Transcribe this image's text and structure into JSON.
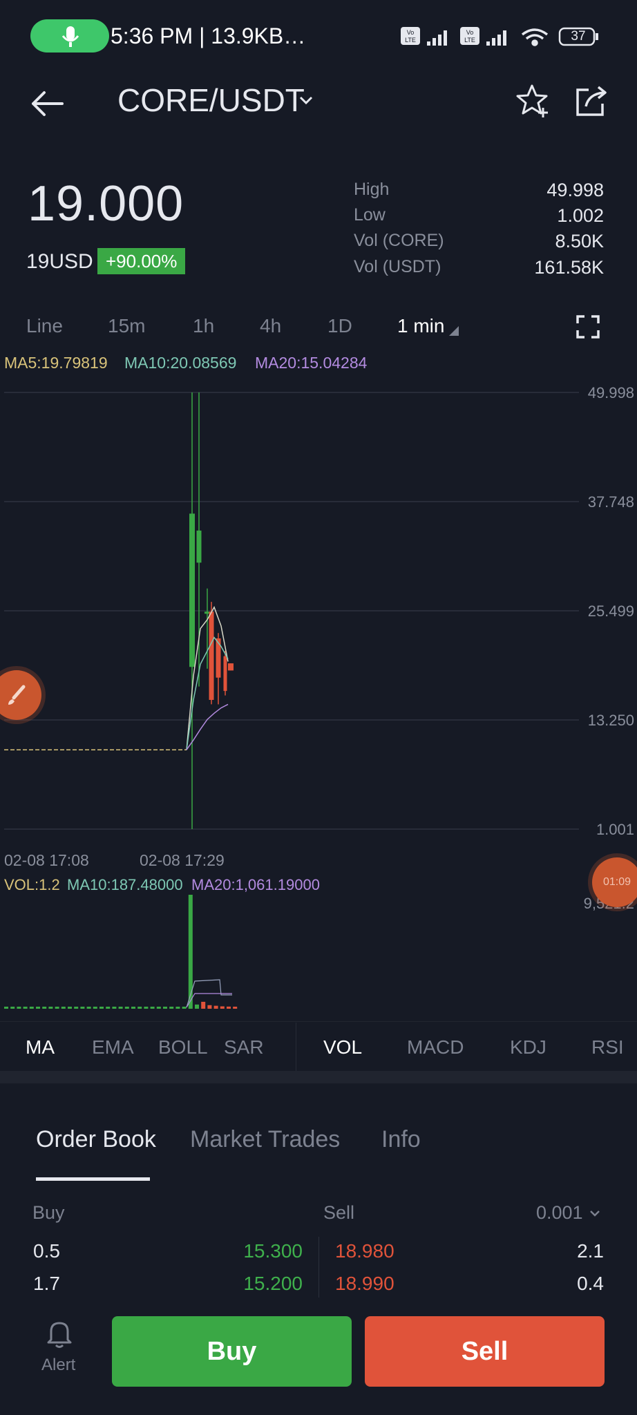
{
  "status_bar": {
    "time_text": "5:36 PM | 13.9KB…",
    "battery": "37",
    "icons": [
      "mic-icon",
      "volte-icon",
      "signal-icon",
      "volte-icon",
      "signal-icon",
      "wifi-icon",
      "battery-icon"
    ]
  },
  "header": {
    "title": "CORE/USDT",
    "icons": [
      "back-arrow-icon",
      "chevron-down-icon",
      "star-add-icon",
      "share-icon"
    ]
  },
  "price": {
    "last": "19.000",
    "fiat": "19USD",
    "change": "+90.00%",
    "stats": [
      {
        "label": "High",
        "value": "49.998"
      },
      {
        "label": "Low",
        "value": "1.002"
      },
      {
        "label": "Vol (CORE)",
        "value": "8.50K"
      },
      {
        "label": "Vol (USDT)",
        "value": "161.58K"
      }
    ]
  },
  "timeframes": [
    "Line",
    "15m",
    "1h",
    "4h",
    "1D",
    "1 min"
  ],
  "active_timeframe": "1 min",
  "ma_legend": {
    "ma5": "MA5:19.79819",
    "ma10": "MA10:20.08569",
    "ma20": "MA20:15.04284"
  },
  "chart_data": {
    "type": "candlestick",
    "y_axis_ticks": [
      "49.998",
      "37.748",
      "25.499",
      "13.250",
      "1.001"
    ],
    "ylim": [
      1.001,
      49.998
    ],
    "x_labels": [
      "02-08 17:08",
      "02-08 17:29"
    ],
    "candles": [
      {
        "open": 9.9,
        "close": 9.9,
        "high": 9.9,
        "low": 9.9,
        "color": "flat"
      },
      {
        "open": 19.2,
        "close": 36.4,
        "high": 49.998,
        "low": 1.002,
        "color": "up"
      },
      {
        "open": 30.9,
        "close": 34.5,
        "high": 49.998,
        "low": 17.0,
        "color": "up"
      },
      {
        "open": 25.4,
        "close": 25.4,
        "high": 28.0,
        "low": 19.0,
        "color": "up"
      },
      {
        "open": 25.4,
        "close": 15.5,
        "high": 26.5,
        "low": 15.0,
        "color": "down"
      },
      {
        "open": 22.4,
        "close": 18.0,
        "high": 23.0,
        "low": 15.0,
        "color": "down"
      },
      {
        "open": 20.4,
        "close": 16.5,
        "high": 21.0,
        "low": 16.0,
        "color": "down"
      },
      {
        "open": 19.6,
        "close": 18.8,
        "high": 19.6,
        "low": 18.8,
        "color": "down"
      }
    ],
    "volume": {
      "axis_max": "9,521.2",
      "legend": {
        "vol": "VOL:1.2",
        "ma10": "MA10:187.48000",
        "ma20": "MA20:1,061.19000"
      },
      "bars": [
        1,
        1,
        1,
        1,
        1,
        1,
        1,
        1,
        1,
        1,
        1,
        1,
        1,
        1,
        1,
        1,
        1,
        1,
        1,
        1,
        1,
        1,
        1,
        1,
        1,
        1,
        1,
        1,
        1,
        9521,
        350,
        580,
        300,
        250,
        200,
        180,
        150
      ]
    }
  },
  "colors": {
    "up": "#3aa845",
    "down": "#e0533a",
    "ma5": "#d9c37a",
    "ma10": "#7ec8b4",
    "ma20": "#b38be0",
    "background": "#161a25"
  },
  "indicators": {
    "main": [
      "MA",
      "EMA",
      "BOLL",
      "SAR"
    ],
    "sub": [
      "VOL",
      "MACD",
      "KDJ",
      "RSI"
    ],
    "active_main": "MA",
    "active_sub": "VOL"
  },
  "timer_bubble": "01:09",
  "tabs": [
    "Order Book",
    "Market Trades",
    "Info"
  ],
  "order_book": {
    "buy_header": "Buy",
    "sell_header": "Sell",
    "precision": "0.001",
    "rows": [
      {
        "buy_qty": "0.5",
        "buy_price": "15.300",
        "sell_price": "18.980",
        "sell_qty": "2.1"
      },
      {
        "buy_qty": "1.7",
        "buy_price": "15.200",
        "sell_price": "18.990",
        "sell_qty": "0.4"
      }
    ]
  },
  "bottom_bar": {
    "alert": "Alert",
    "buy": "Buy",
    "sell": "Sell"
  }
}
